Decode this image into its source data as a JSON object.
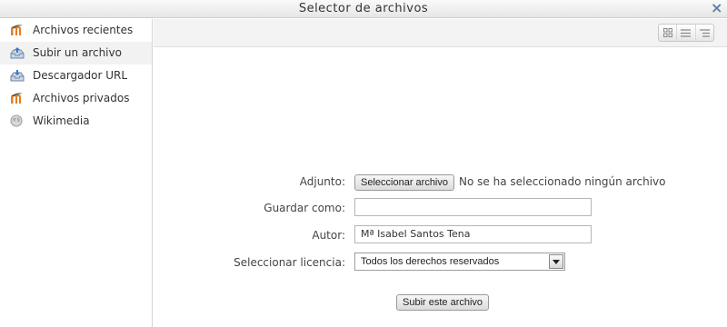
{
  "dialog": {
    "title": "Selector de archivos",
    "close_label": "×"
  },
  "sidebar": {
    "items": [
      {
        "label": "Archivos recientes",
        "icon": "moodle-icon",
        "selected": false
      },
      {
        "label": "Subir un archivo",
        "icon": "upload-icon",
        "selected": true
      },
      {
        "label": "Descargador URL",
        "icon": "url-download-icon",
        "selected": false
      },
      {
        "label": "Archivos privados",
        "icon": "moodle-icon",
        "selected": false
      },
      {
        "label": "Wikimedia",
        "icon": "wikimedia-icon",
        "selected": false
      }
    ]
  },
  "toolbar": {
    "view_buttons": [
      "icon-view-icon",
      "list-view-icon",
      "tree-view-icon"
    ]
  },
  "form": {
    "attachment": {
      "label": "Adjunto:",
      "button": "Seleccionar archivo",
      "status": "No se ha seleccionado ningún archivo"
    },
    "save_as": {
      "label": "Guardar como:",
      "value": ""
    },
    "author": {
      "label": "Autor:",
      "value": "Mª Isabel Santos Tena"
    },
    "license": {
      "label": "Seleccionar licencia:",
      "value": "Todos los derechos reservados"
    },
    "submit_label": "Subir este archivo"
  },
  "colors": {
    "moodle_orange": "#e87c1e",
    "close_blue": "#5b7fa8"
  }
}
